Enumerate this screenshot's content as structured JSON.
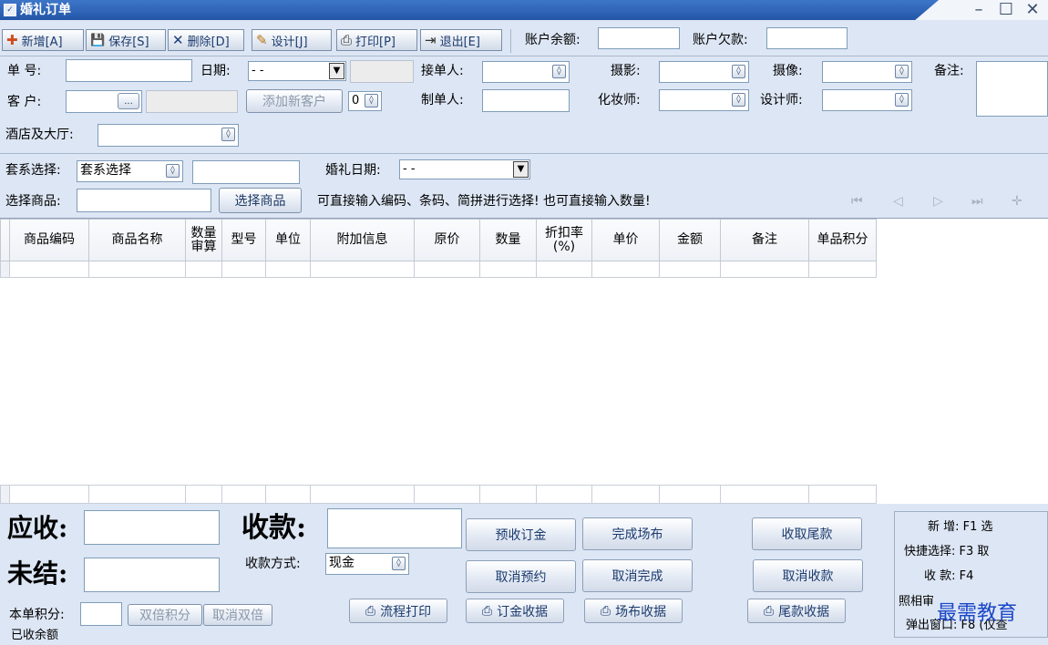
{
  "window": {
    "title": "婚礼订单",
    "minimize": "–",
    "maximize": "☐",
    "close": "✕"
  },
  "toolbar": {
    "buttons": [
      {
        "label": "新增[A]",
        "icon": "add-icon",
        "glyph": "✚"
      },
      {
        "label": "保存[S]",
        "icon": "save-icon",
        "glyph": "💾"
      },
      {
        "label": "删除[D]",
        "icon": "delete-icon",
        "glyph": "✕"
      },
      {
        "label": "设计[J]",
        "icon": "design-icon",
        "glyph": "✎"
      },
      {
        "label": "打印[P]",
        "icon": "print-icon",
        "glyph": "⎙"
      },
      {
        "label": "退出[E]",
        "icon": "exit-icon",
        "glyph": "⇥"
      }
    ],
    "balance_label": "账户余额:",
    "balance_value": "",
    "debt_label": "账户欠款:",
    "debt_value": ""
  },
  "form": {
    "order_no_label": "单  号:",
    "order_no_value": "",
    "date_label": "日期:",
    "date_value": "- -",
    "receiver_label": "接单人:",
    "receiver_value": "",
    "photo_label": "摄影:",
    "photo_value": "",
    "video_label": "摄像:",
    "video_value": "",
    "remark_label": "备注:",
    "remark_value": "",
    "customer_label": "客  户:",
    "customer_value": "",
    "browse_label": "...",
    "add_customer_label": "添加新客户",
    "customer_spin_value": "0",
    "maker_label": "制单人:",
    "maker_value": "",
    "makeup_label": "化妆师:",
    "makeup_value": "",
    "designer_label": "设计师:",
    "designer_value": "",
    "hotel_label": "酒店及大厅:",
    "hotel_value": "",
    "package_label": "套系选择:",
    "package_value": "套系选择",
    "package_text": "",
    "wedding_date_label": "婚礼日期:",
    "wedding_date_value": "- -",
    "select_goods_label": "选择商品:",
    "select_goods_value": "",
    "select_goods_button": "选择商品",
    "hint": "可直接输入编码、条码、简拼进行选择! 也可直接输入数量!"
  },
  "nav": {
    "first": "⏮",
    "prev": "◁",
    "next": "▷",
    "last": "⏭",
    "add": "✛"
  },
  "grid": {
    "columns": [
      "商品编码",
      "商品名称",
      "数量\n审算",
      "型号",
      "单位",
      "附加信息",
      "原价",
      "数量",
      "折扣率\n(%)",
      "单价",
      "金额",
      "备注",
      "单品积分"
    ]
  },
  "bottom": {
    "receivable_label": "应收:",
    "receivable_value": "",
    "payment_label": "收款:",
    "payment_value": "",
    "unsettled_label": "未结:",
    "unsettled_value": "",
    "pay_method_label": "收款方式:",
    "pay_method_value": "现金",
    "points_label": "本单积分:",
    "points_value": "",
    "double_points": "双倍积分",
    "cancel_double": "取消双倍",
    "paid_label": "已收余额",
    "actions": {
      "deposit": "预收订金",
      "complete_setup": "完成场布",
      "collect_balance": "收取尾款",
      "cancel_booking": "取消预约",
      "cancel_complete": "取消完成",
      "cancel_payment": "取消收款"
    },
    "prints": {
      "flow": "流程打印",
      "deposit_receipt": "订金收据",
      "setup_receipt": "场布收据",
      "balance_receipt": "尾款收据"
    }
  },
  "hotkeys": {
    "line1": "新  增: F1      选",
    "line2": "快捷选择: F3     取",
    "line3": "收  款: F4",
    "line4": "照相审",
    "line5": "弹出窗口: F8 (仅查"
  },
  "watermark": "最需教育"
}
